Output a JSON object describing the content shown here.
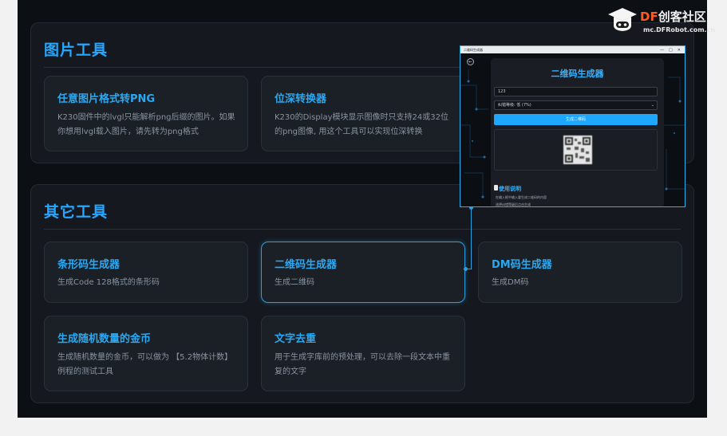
{
  "section_image_tools": {
    "title": "图片工具",
    "cards": [
      {
        "title": "任意图片格式转PNG",
        "desc": "K230固件中的lvgl只能解析png后缀的图片。如果你想用lvgl载入图片，请先转为png格式"
      },
      {
        "title": "位深转换器",
        "desc": "K230的Display模块显示图像时只支持24或32位的png图像, 用这个工具可以实现位深转换"
      }
    ]
  },
  "section_other_tools": {
    "title": "其它工具",
    "cards": [
      {
        "title": "条形码生成器",
        "desc": "生成Code 128格式的条形码"
      },
      {
        "title": "二维码生成器",
        "desc": "生成二维码"
      },
      {
        "title": "DM码生成器",
        "desc": "生成DM码"
      },
      {
        "title": "生成随机数量的金币",
        "desc": "生成随机数量的金币，可以做为 【5.2物体计数】例程的测试工具"
      },
      {
        "title": "文字去重",
        "desc": "用于生成字库前的预处理，可以去除一段文本中重复的文字"
      }
    ]
  },
  "popup": {
    "window_title": "二维码生成器",
    "controls": [
      "—",
      "□",
      "✕"
    ],
    "heading": "二维码生成器",
    "input_value": "123",
    "select_value": "纠错等级: 低 (7%)",
    "button_label": "生成二维码",
    "help_title": "使用说明",
    "help_items": [
      "在输入框中输入要生成二维码的内容",
      "选择纠错等级后点击生成"
    ]
  },
  "logo": {
    "df": "DF",
    "name": "创客社区",
    "url": "mc.DFRobot.com.cn"
  },
  "colors": {
    "accent": "#26a8ff",
    "background": "#0c0f14",
    "card": "#1b2027",
    "logo_orange": "#ff5a1f"
  },
  "icons": [
    "back-arrow-icon",
    "document-icon",
    "robot-logo-icon",
    "dropdown-arrow-icon"
  ]
}
